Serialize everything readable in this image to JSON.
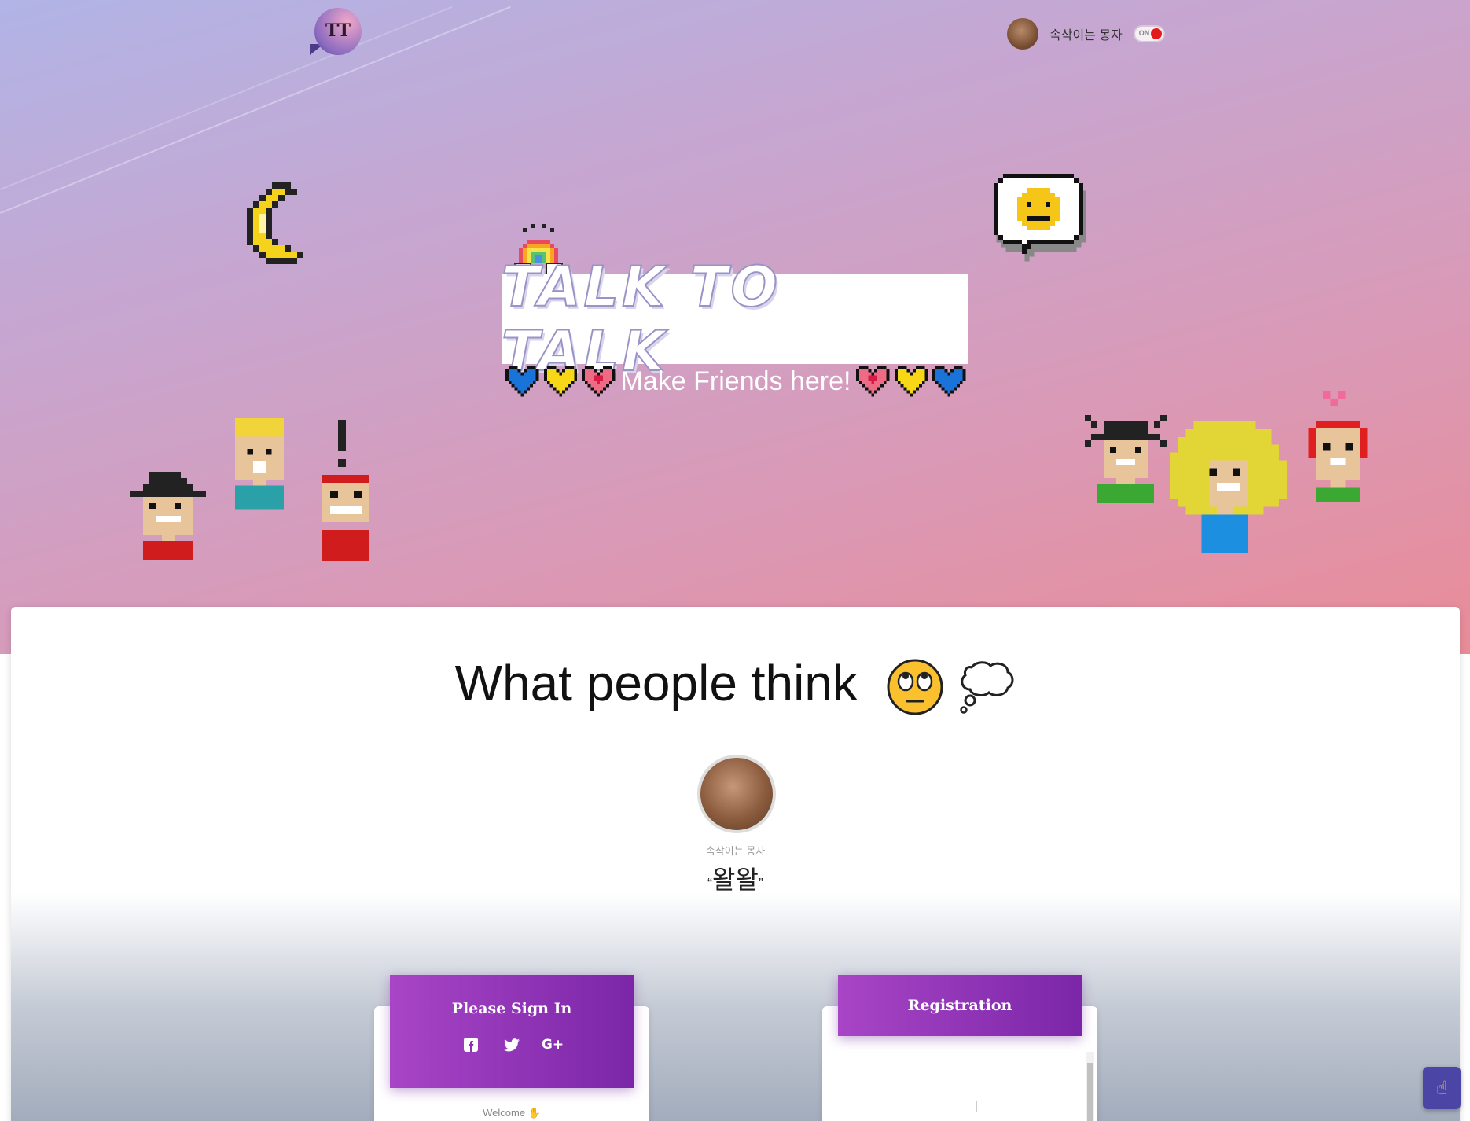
{
  "header": {
    "logo_text": "TT",
    "user_name": "속삭이는 몽자",
    "toggle_label": "ON"
  },
  "hero": {
    "title": "TALK TO TALK",
    "tagline": "Make Friends here!"
  },
  "testimonial": {
    "heading": "What people think",
    "author": "속삭이는 몽자",
    "open_quote": "“",
    "quote": "왈왈",
    "close_quote": "”"
  },
  "signin": {
    "title": "Please Sign In",
    "welcome": "Welcome",
    "facebook_icon": "facebook-icon",
    "twitter_icon": "twitter-icon",
    "google_icon": "google-plus-icon",
    "google_label": "G+"
  },
  "registration": {
    "title": "Registration"
  },
  "colors": {
    "accent_start": "#a845c6",
    "accent_end": "#7b26a8",
    "toggle_on": "#e21b1b",
    "fab": "#4b45a5"
  }
}
